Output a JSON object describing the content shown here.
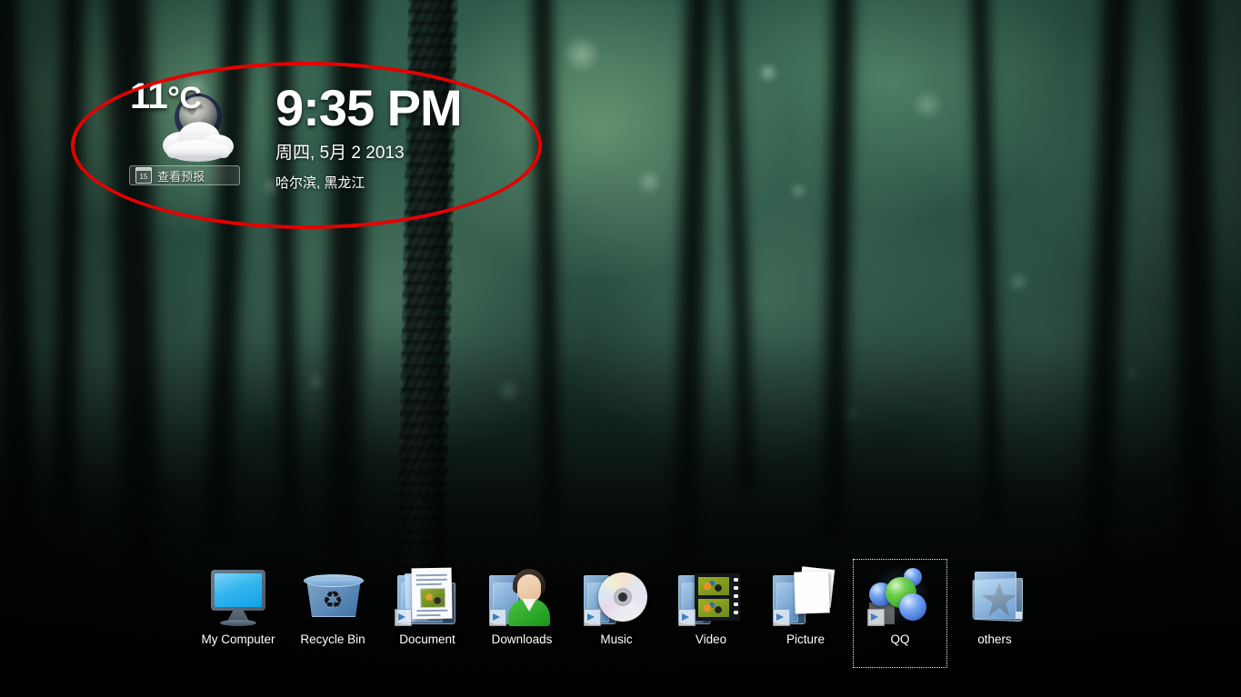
{
  "gadget": {
    "weather": {
      "temperature": "11",
      "unit": "°C",
      "icon_name": "night-cloudy-icon",
      "forecast_button_label": "查看预报",
      "calendar_day": "15"
    },
    "clock": {
      "time": "9:35 PM",
      "date": "周四, 5月 2 2013",
      "location": "哈尔滨, 黑龙江"
    }
  },
  "annotation": {
    "shape": "ellipse",
    "color": "#e60000",
    "target": "clock-and-weather-gadget"
  },
  "desktop": {
    "icons": [
      {
        "label": "My Computer",
        "icon_name": "my-computer-icon",
        "selected": false
      },
      {
        "label": "Recycle Bin",
        "icon_name": "recycle-bin-icon",
        "selected": false
      },
      {
        "label": "Document",
        "icon_name": "documents-folder-icon",
        "selected": false
      },
      {
        "label": "Downloads",
        "icon_name": "downloads-user-icon",
        "selected": false
      },
      {
        "label": "Music",
        "icon_name": "music-cd-icon",
        "selected": false
      },
      {
        "label": "Video",
        "icon_name": "video-film-icon",
        "selected": false
      },
      {
        "label": "Picture",
        "icon_name": "pictures-stack-icon",
        "selected": false
      },
      {
        "label": "QQ",
        "icon_name": "qq-spheres-icon",
        "selected": true
      },
      {
        "label": "others",
        "icon_name": "others-folder-star-icon",
        "selected": false
      }
    ]
  },
  "wallpaper": {
    "description": "blurred forest with dark tree trunks",
    "accent_green": "#2e5a4a",
    "shadow_dark": "#020504"
  }
}
